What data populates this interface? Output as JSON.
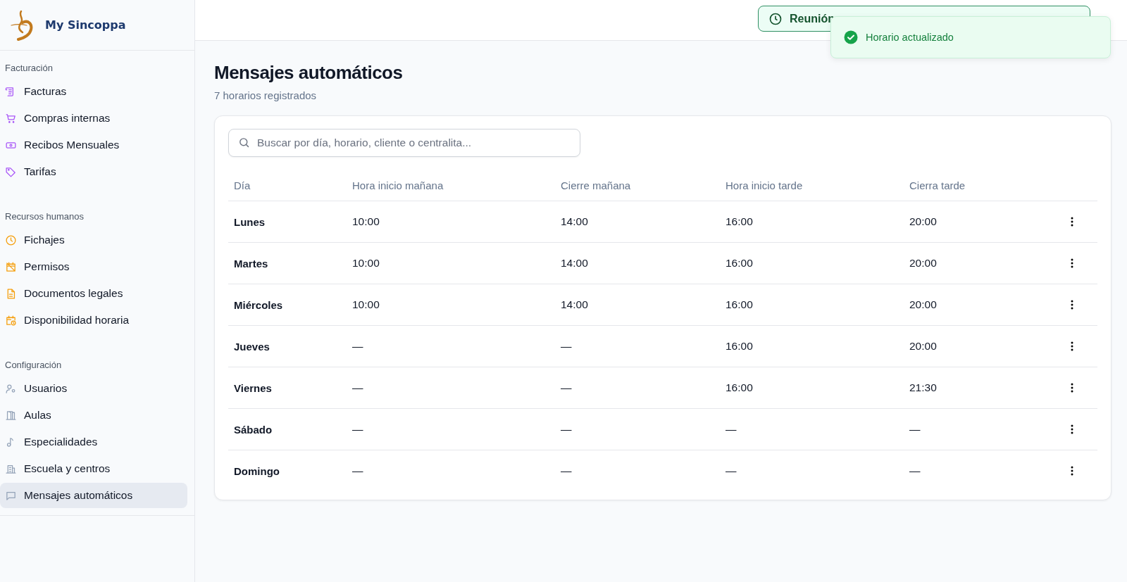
{
  "brand": {
    "name": "My Sincoppa"
  },
  "sidebar": {
    "groups": [
      {
        "title": "Facturación",
        "color": "#a855f7",
        "items": [
          {
            "label": "Facturas",
            "kind": "receipt",
            "selected": false
          },
          {
            "label": "Compras internas",
            "kind": "cart",
            "selected": false
          },
          {
            "label": "Recibos Mensuales",
            "kind": "banknote",
            "selected": false
          },
          {
            "label": "Tarifas",
            "kind": "tag",
            "selected": false
          }
        ]
      },
      {
        "title": "Recursos humanos",
        "color": "#f59e0b",
        "items": [
          {
            "label": "Fichajes",
            "kind": "clock",
            "selected": false
          },
          {
            "label": "Permisos",
            "kind": "calendar",
            "selected": false
          },
          {
            "label": "Documentos legales",
            "kind": "file",
            "selected": false
          },
          {
            "label": "Disponibilidad horaria",
            "kind": "schedule",
            "selected": false
          }
        ]
      },
      {
        "title": "Configuración",
        "color": "#94a3b8",
        "items": [
          {
            "label": "Usuarios",
            "kind": "users",
            "selected": false
          },
          {
            "label": "Aulas",
            "kind": "door",
            "selected": false
          },
          {
            "label": "Especialidades",
            "kind": "note",
            "selected": false
          },
          {
            "label": "Escuela y centros",
            "kind": "building",
            "selected": false
          },
          {
            "label": "Mensajes automáticos",
            "kind": "message",
            "selected": true
          }
        ]
      }
    ]
  },
  "banner": {
    "text": "Reunión"
  },
  "toast": {
    "text": "Horario actualizado"
  },
  "page": {
    "title": "Mensajes automáticos",
    "subtitle": "7 horarios registrados"
  },
  "search": {
    "placeholder": "Buscar por día, horario, cliente o centralita..."
  },
  "table": {
    "columns": [
      "Día",
      "Hora inicio mañana",
      "Cierre mañana",
      "Hora inicio tarde",
      "Cierra tarde"
    ],
    "rows": [
      {
        "cells": [
          "Lunes",
          "10:00",
          "14:00",
          "16:00",
          "20:00"
        ]
      },
      {
        "cells": [
          "Martes",
          "10:00",
          "14:00",
          "16:00",
          "20:00"
        ]
      },
      {
        "cells": [
          "Miércoles",
          "10:00",
          "14:00",
          "16:00",
          "20:00"
        ]
      },
      {
        "cells": [
          "Jueves",
          "—",
          "—",
          "16:00",
          "20:00"
        ]
      },
      {
        "cells": [
          "Viernes",
          "—",
          "—",
          "16:00",
          "21:30"
        ]
      },
      {
        "cells": [
          "Sábado",
          "—",
          "—",
          "—",
          "—"
        ]
      },
      {
        "cells": [
          "Domingo",
          "—",
          "—",
          "—",
          "—"
        ]
      }
    ]
  }
}
